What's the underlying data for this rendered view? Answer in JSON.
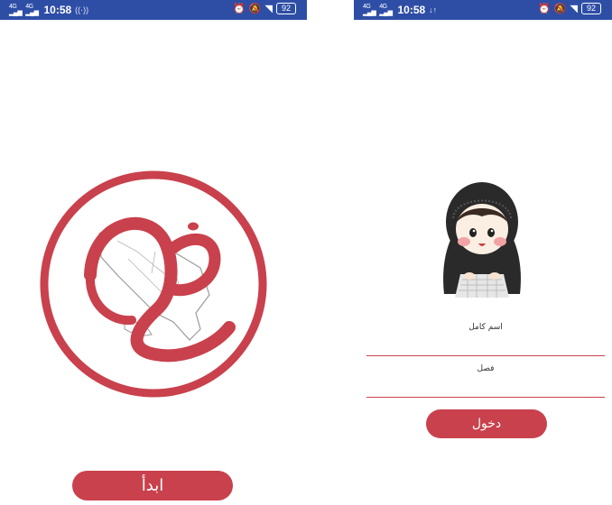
{
  "left_screen": {
    "status_bar": {
      "network1": "4G",
      "network2": "4G",
      "time": "10:58",
      "activity": "((·))",
      "battery": "92"
    },
    "start_button_label": "ابدأ"
  },
  "right_screen": {
    "status_bar": {
      "network1": "4G",
      "network2": "4G",
      "time": "10:58",
      "activity": "↓↑",
      "battery": "92"
    },
    "name_field_label": "اسم كامل",
    "class_field_label": "فصل",
    "login_button_label": "دخول"
  },
  "colors": {
    "status_bar": "#2e4ea6",
    "accent": "#c9414c"
  },
  "icons": [
    "signal-icon",
    "alarm-icon",
    "mute-icon",
    "wifi-icon",
    "battery-icon"
  ]
}
